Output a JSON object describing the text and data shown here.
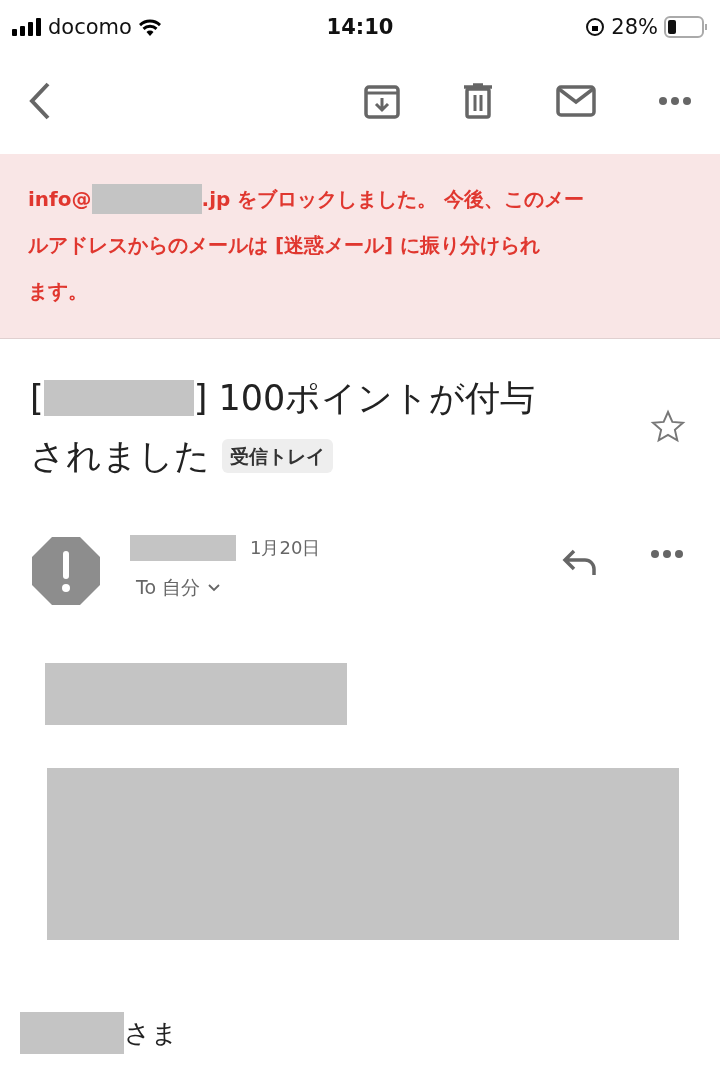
{
  "status_bar": {
    "carrier": "docomo",
    "time": "14:10",
    "battery": "28%"
  },
  "banner": {
    "before": "info@",
    "after": ".jp をブロックしました。 今後、このメー",
    "lines": [
      "ルアドレスからのメールは [迷惑メール] に振り分けられ",
      "ます。"
    ]
  },
  "subject": {
    "open": "[",
    "text": "] 100ポイントが付与",
    "line2": "されました",
    "label": "受信トレイ",
    "starred": false
  },
  "message": {
    "date": "1月20日",
    "recipient": "To 自分"
  },
  "body": {
    "salutation": "さま"
  }
}
